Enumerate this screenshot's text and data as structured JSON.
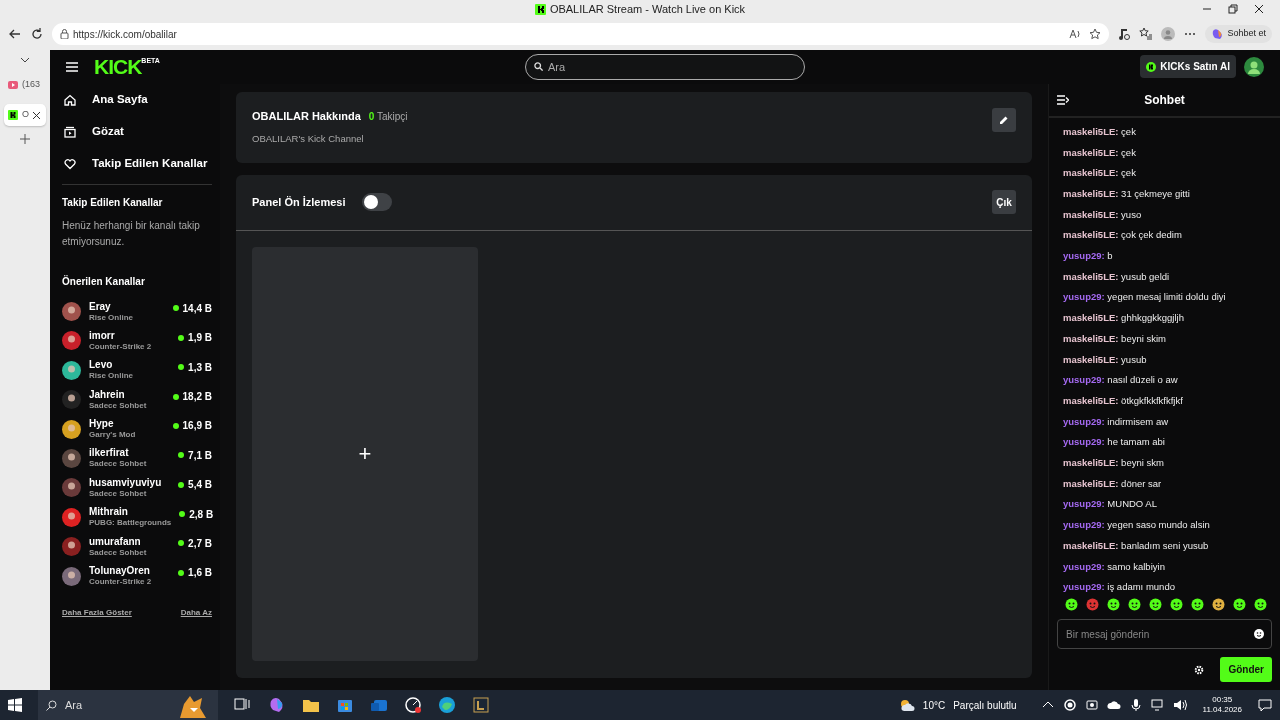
{
  "browser": {
    "title": "OBALILAR Stream - Watch Live on Kick",
    "url": "https://kick.com/obalilar",
    "copilot_button": "Sohbet et",
    "tabs": [
      {
        "label": "(163",
        "selected": false
      },
      {
        "label": "O",
        "selected": true
      }
    ]
  },
  "header": {
    "logo": "KICK",
    "logo_badge": "BETA",
    "search": {
      "placeholder": "Ara"
    },
    "buy_button": "KICKs Satın Al"
  },
  "sidebar": {
    "nav": [
      {
        "label": "Ana Sayfa"
      },
      {
        "label": "Gözat"
      },
      {
        "label": "Takip Edilen Kanallar"
      }
    ],
    "followed_title": "Takip Edilen Kanallar",
    "followed_empty": "Henüz herhangi bir kanalı takip etmiyorsunuz.",
    "recommended_title": "Önerilen Kanallar",
    "channels": [
      {
        "name": "Eray",
        "category": "Rise Online",
        "viewers": "14,4 B"
      },
      {
        "name": "imorr",
        "category": "Counter-Strike 2",
        "viewers": "1,9 B"
      },
      {
        "name": "Levo",
        "category": "Rise Online",
        "viewers": "1,3 B"
      },
      {
        "name": "Jahrein",
        "category": "Sadece Sohbet",
        "viewers": "18,2 B"
      },
      {
        "name": "Hype",
        "category": "Garry's Mod",
        "viewers": "16,9 B"
      },
      {
        "name": "ilkerfirat",
        "category": "Sadece Sohbet",
        "viewers": "7,1 B"
      },
      {
        "name": "husamviyuviyu",
        "category": "Sadece Sohbet",
        "viewers": "5,4 B"
      },
      {
        "name": "Mithrain",
        "category": "PUBG: Battlegrounds",
        "viewers": "2,8 B"
      },
      {
        "name": "umurafann",
        "category": "Sadece Sohbet",
        "viewers": "2,7 B"
      },
      {
        "name": "TolunayOren",
        "category": "Counter-Strike 2",
        "viewers": "1,6 B"
      }
    ],
    "show_more": "Daha Fazla Göster",
    "show_less": "Daha Az"
  },
  "about": {
    "title": "OBALILAR Hakkında",
    "followers_count": "0",
    "followers_label": "Takipçi",
    "description": "OBALILAR's Kick Channel"
  },
  "panel": {
    "label": "Panel Ön İzlemesi",
    "on": false,
    "exit_button": "Çık",
    "add_tile": "+"
  },
  "chat": {
    "title": "Sohbet",
    "messages": [
      {
        "user": "maskeli5LE:",
        "color": "#e6c3cf",
        "text": "çek"
      },
      {
        "user": "maskeli5LE:",
        "color": "#e6c3cf",
        "text": "çek"
      },
      {
        "user": "maskeli5LE:",
        "color": "#e6c3cf",
        "text": "çek"
      },
      {
        "user": "maskeli5LE:",
        "color": "#e6c3cf",
        "text": "31 çekmeye gitti"
      },
      {
        "user": "maskeli5LE:",
        "color": "#e6c3cf",
        "text": "yuso"
      },
      {
        "user": "maskeli5LE:",
        "color": "#e6c3cf",
        "text": "çok çek dedim"
      },
      {
        "user": "yusup29:",
        "color": "#a56af2",
        "text": "b"
      },
      {
        "user": "maskeli5LE:",
        "color": "#e6c3cf",
        "text": "yusub geldi"
      },
      {
        "user": "yusup29:",
        "color": "#a56af2",
        "text": "yegen mesaj limiti doldu diyi"
      },
      {
        "user": "maskeli5LE:",
        "color": "#e6c3cf",
        "text": "ghhkggkkggjljh"
      },
      {
        "user": "maskeli5LE:",
        "color": "#e6c3cf",
        "text": "beyni skim"
      },
      {
        "user": "maskeli5LE:",
        "color": "#e6c3cf",
        "text": "yusub"
      },
      {
        "user": "yusup29:",
        "color": "#a56af2",
        "text": "nasıl düzeli o aw"
      },
      {
        "user": "maskeli5LE:",
        "color": "#e6c3cf",
        "text": "ötkgkfkkfkfkfjkf"
      },
      {
        "user": "yusup29:",
        "color": "#a56af2",
        "text": "indirmisem aw"
      },
      {
        "user": "yusup29:",
        "color": "#a56af2",
        "text": "he tamam abi"
      },
      {
        "user": "maskeli5LE:",
        "color": "#e6c3cf",
        "text": "beyni skm"
      },
      {
        "user": "maskeli5LE:",
        "color": "#e6c3cf",
        "text": "döner sar"
      },
      {
        "user": "yusup29:",
        "color": "#a56af2",
        "text": "MUNDO AL"
      },
      {
        "user": "yusup29:",
        "color": "#a56af2",
        "text": "yegen saso mundo alsin"
      },
      {
        "user": "maskeli5LE:",
        "color": "#e6c3cf",
        "text": "banladım seni yusub"
      },
      {
        "user": "yusup29:",
        "color": "#a56af2",
        "text": "samo kalbiyin"
      },
      {
        "user": "yusup29:",
        "color": "#a56af2",
        "text": "iş adamı mundo"
      }
    ],
    "input": {
      "placeholder": "Bir mesaj gönderin"
    },
    "send_button": "Gönder"
  },
  "taskbar": {
    "search": "Ara",
    "temperature": "10°C",
    "weather": "Parçalı bulutlu",
    "time": "00:35",
    "date": "11.04.2026"
  }
}
